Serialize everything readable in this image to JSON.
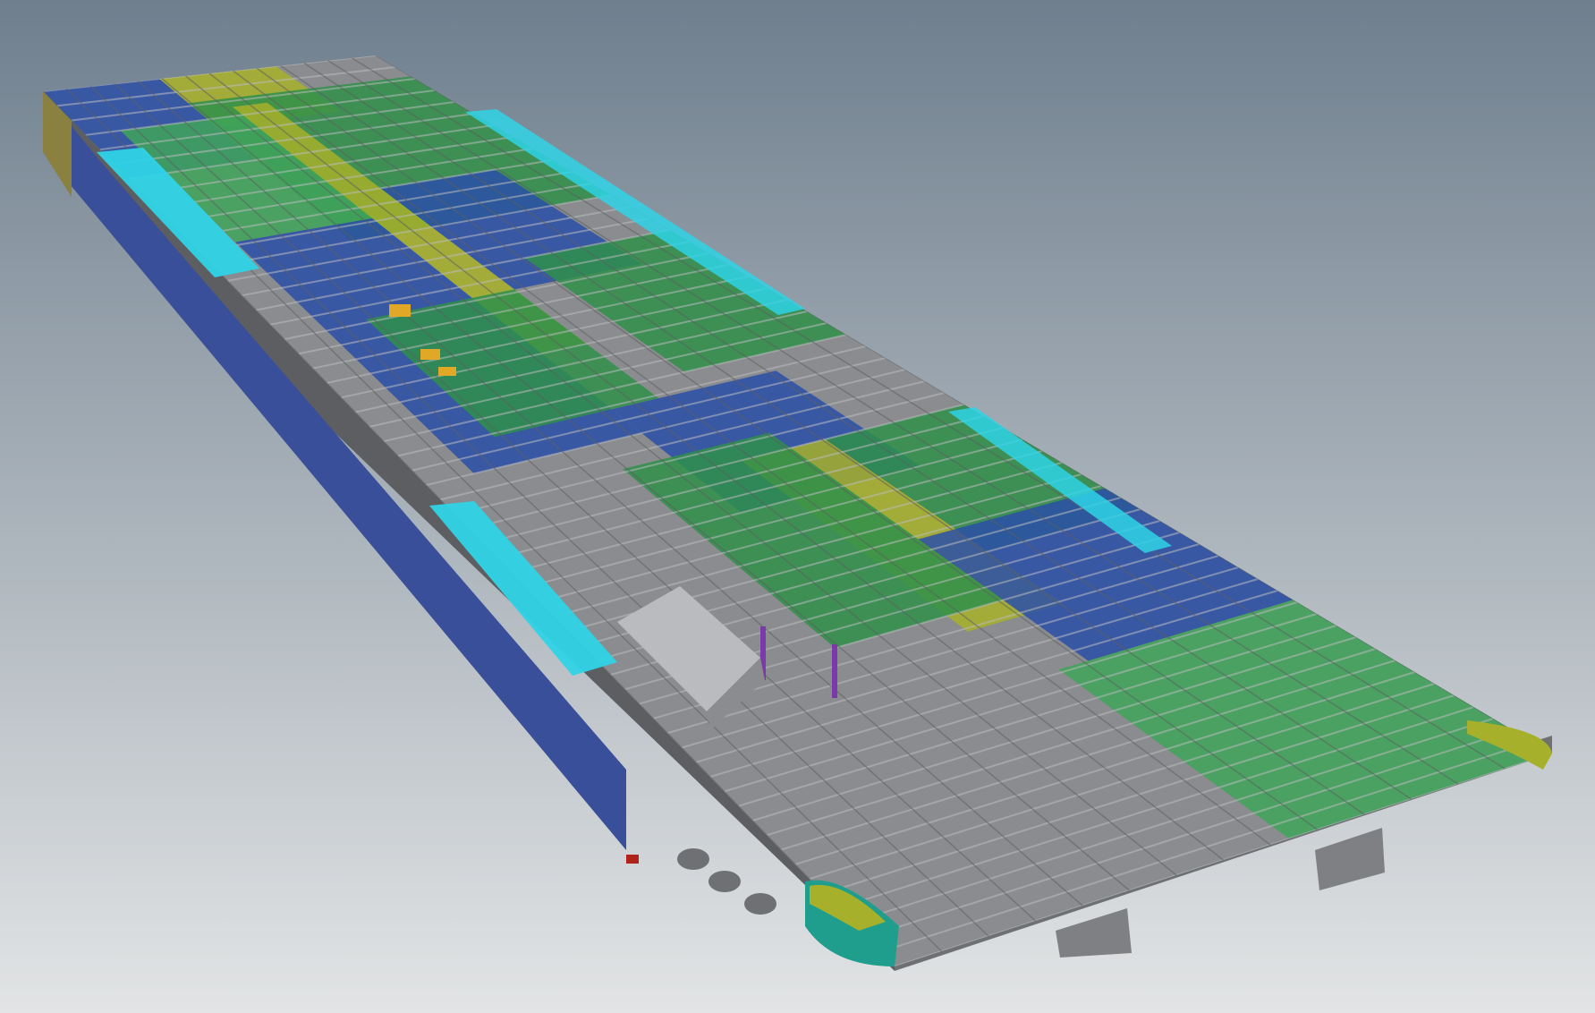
{
  "viewport": {
    "background_top": "#6f7f8e",
    "background_bottom": "#e2e4e5"
  },
  "model": {
    "name": "",
    "colors": {
      "frame": "#8a8c8f",
      "frame_dark": "#5c5e61",
      "frame_light": "#b9bbbe",
      "deck_green": "#2f8f4a",
      "deck_green_light": "#3fa55a",
      "deck_blue": "#2a4fa8",
      "deck_yellow": "#a7b02a",
      "accent_cyan": "#2fd3e6",
      "accent_gold": "#e0a826",
      "accent_red": "#b0231d",
      "accent_purple": "#7a3aa8",
      "accent_teal": "#1f9e8e"
    }
  }
}
